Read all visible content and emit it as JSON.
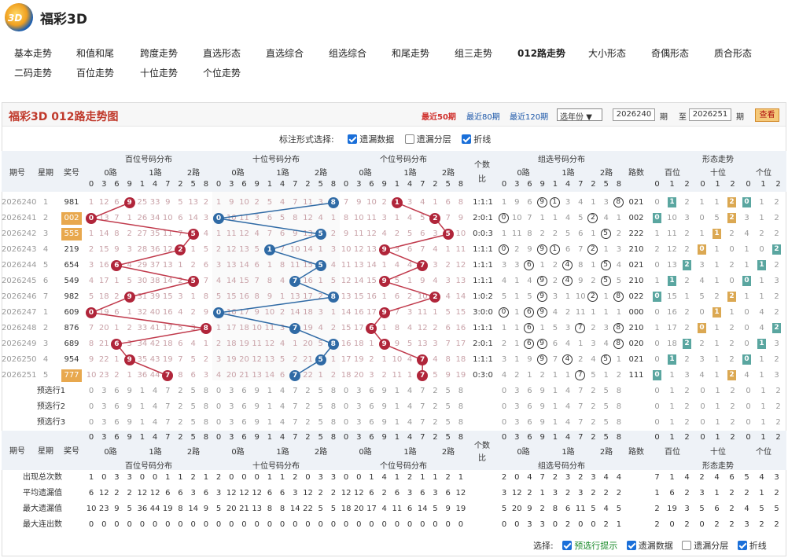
{
  "app": {
    "title": "福彩3D"
  },
  "nav": {
    "row1": [
      "基本走势",
      "和值和尾",
      "跨度走势",
      "直选形态",
      "直选综合",
      "组选综合",
      "和尾走势",
      "组三走势",
      "012路走势",
      "大小形态",
      "奇偶形态",
      "质合形态"
    ],
    "row2": [
      "二码走势",
      "百位走势",
      "十位走势",
      "个位走势"
    ],
    "active": "012路走势"
  },
  "panel": {
    "title": "福彩3D 012路走势图",
    "links": [
      "最近50期",
      "最近80期",
      "最近120期"
    ],
    "year_select": "选年份",
    "from_label": "期",
    "to_label": "至",
    "end_label": "期",
    "from_value": "2026240",
    "to_value": "2026251",
    "view_button": "查看"
  },
  "mark_options": {
    "label": "标注形式选择:",
    "items": [
      {
        "label": "遗漏数据",
        "checked": true
      },
      {
        "label": "遗漏分层",
        "checked": false
      },
      {
        "label": "折线",
        "checked": true
      }
    ]
  },
  "headers": {
    "issue": "期号",
    "week": "星期",
    "prize": "奖号",
    "hundreds": "百位号码分布",
    "tens": "十位号码分布",
    "units": "个位号码分布",
    "ratio1": "个数",
    "ratio2": "比",
    "group": "组选号码分布",
    "route": "路数",
    "shape": "形态走势",
    "pos": [
      "百位",
      "十位",
      "个位"
    ],
    "paths": [
      "0路",
      "1路",
      "2路"
    ],
    "digits": [
      "0",
      "3",
      "6",
      "9",
      "1",
      "4",
      "7",
      "2",
      "5",
      "8"
    ],
    "routes012": [
      "0",
      "1",
      "2"
    ]
  },
  "rows": [
    {
      "issue": "2026240",
      "week": "1",
      "prize": "981",
      "ratio": "1:1:1",
      "route": "021"
    },
    {
      "issue": "2026241",
      "week": "2",
      "prize": "002",
      "ratio": "2:0:1",
      "route": "002"
    },
    {
      "issue": "2026242",
      "week": "3",
      "prize": "555",
      "ratio": "0:0:3",
      "route": "222"
    },
    {
      "issue": "2026243",
      "week": "4",
      "prize": "219",
      "ratio": "1:1:1",
      "route": "210"
    },
    {
      "issue": "2026244",
      "week": "5",
      "prize": "654",
      "ratio": "1:1:1",
      "route": "021"
    },
    {
      "issue": "2026245",
      "week": "6",
      "prize": "549",
      "ratio": "1:1:1",
      "route": "210"
    },
    {
      "issue": "2026246",
      "week": "7",
      "prize": "982",
      "ratio": "1:0:2",
      "route": "022"
    },
    {
      "issue": "2026247",
      "week": "1",
      "prize": "609",
      "ratio": "3:0:0",
      "route": "000"
    },
    {
      "issue": "2026248",
      "week": "2",
      "prize": "876",
      "ratio": "1:1:1",
      "route": "210"
    },
    {
      "issue": "2026249",
      "week": "3",
      "prize": "689",
      "ratio": "2:0:1",
      "route": "020"
    },
    {
      "issue": "2026250",
      "week": "4",
      "prize": "954",
      "ratio": "1:1:1",
      "route": "021"
    },
    {
      "issue": "2026251",
      "week": "5",
      "prize": "777",
      "ratio": "0:3:0",
      "route": "111"
    }
  ],
  "hundreds_miss": [
    [
      "1",
      "12",
      "6",
      "9",
      "25",
      "33",
      "9",
      "5",
      "13",
      "2"
    ],
    [
      "0",
      "13",
      "7",
      "1",
      "26",
      "34",
      "10",
      "6",
      "14",
      "3"
    ],
    [
      "1",
      "14",
      "8",
      "2",
      "27",
      "35",
      "11",
      "7",
      "5",
      "4"
    ],
    [
      "2",
      "15",
      "9",
      "3",
      "28",
      "36",
      "12",
      "2",
      "1",
      "5"
    ],
    [
      "3",
      "16",
      "6",
      "4",
      "29",
      "37",
      "13",
      "1",
      "2",
      "6"
    ],
    [
      "4",
      "17",
      "1",
      "5",
      "30",
      "38",
      "14",
      "2",
      "5",
      "7"
    ],
    [
      "5",
      "18",
      "2",
      "9",
      "31",
      "39",
      "15",
      "3",
      "1",
      "8"
    ],
    [
      "6",
      "19",
      "6",
      "1",
      "32",
      "40",
      "16",
      "4",
      "2",
      "9"
    ],
    [
      "7",
      "20",
      "1",
      "2",
      "33",
      "41",
      "17",
      "5",
      "3",
      "8"
    ],
    [
      "8",
      "21",
      "6",
      "3",
      "34",
      "42",
      "18",
      "6",
      "4",
      "1"
    ],
    [
      "9",
      "22",
      "1",
      "9",
      "35",
      "43",
      "19",
      "7",
      "5",
      "2"
    ],
    [
      "10",
      "23",
      "2",
      "1",
      "36",
      "44",
      "7",
      "8",
      "6",
      "3"
    ]
  ],
  "tens_miss": [
    [
      "1",
      "9",
      "10",
      "2",
      "5",
      "4",
      "7",
      "11",
      "3",
      "8"
    ],
    [
      "0",
      "10",
      "11",
      "3",
      "6",
      "5",
      "8",
      "12",
      "4",
      "1"
    ],
    [
      "1",
      "11",
      "12",
      "4",
      "7",
      "6",
      "9",
      "13",
      "5",
      "2"
    ],
    [
      "2",
      "12",
      "13",
      "5",
      "1",
      "7",
      "10",
      "14",
      "1",
      "3"
    ],
    [
      "3",
      "13",
      "14",
      "6",
      "1",
      "8",
      "11",
      "15",
      "5",
      "4"
    ],
    [
      "4",
      "14",
      "15",
      "7",
      "8",
      "4",
      "12",
      "16",
      "1",
      "5"
    ],
    [
      "5",
      "15",
      "16",
      "8",
      "9",
      "1",
      "13",
      "17",
      "2",
      "8"
    ],
    [
      "0",
      "16",
      "17",
      "9",
      "10",
      "2",
      "14",
      "18",
      "3",
      "1"
    ],
    [
      "1",
      "17",
      "18",
      "10",
      "11",
      "3",
      "7",
      "19",
      "4",
      "2"
    ],
    [
      "2",
      "18",
      "19",
      "11",
      "12",
      "4",
      "1",
      "20",
      "5",
      "8"
    ],
    [
      "3",
      "19",
      "20",
      "12",
      "13",
      "5",
      "2",
      "21",
      "5",
      "1"
    ],
    [
      "4",
      "20",
      "21",
      "13",
      "14",
      "6",
      "7",
      "22",
      "1",
      "2"
    ]
  ],
  "units_miss": [
    [
      "7",
      "9",
      "10",
      "2",
      "1",
      "3",
      "4",
      "1",
      "6",
      "8"
    ],
    [
      "8",
      "10",
      "11",
      "3",
      "1",
      "4",
      "5",
      "2",
      "7",
      "9"
    ],
    [
      "9",
      "11",
      "12",
      "4",
      "2",
      "5",
      "6",
      "3",
      "5",
      "10"
    ],
    [
      "10",
      "12",
      "13",
      "9",
      "3",
      "6",
      "7",
      "4",
      "1",
      "11"
    ],
    [
      "11",
      "13",
      "14",
      "1",
      "4",
      "4",
      "8",
      "3",
      "2",
      "12"
    ],
    [
      "12",
      "14",
      "15",
      "9",
      "5",
      "1",
      "9",
      "4",
      "3",
      "13"
    ],
    [
      "13",
      "15",
      "16",
      "1",
      "6",
      "2",
      "10",
      "2",
      "4",
      "14"
    ],
    [
      "14",
      "16",
      "17",
      "9",
      "7",
      "3",
      "11",
      "1",
      "5",
      "15"
    ],
    [
      "15",
      "17",
      "6",
      "1",
      "8",
      "4",
      "12",
      "2",
      "6",
      "16"
    ],
    [
      "16",
      "18",
      "1",
      "9",
      "9",
      "5",
      "13",
      "3",
      "7",
      "17"
    ],
    [
      "17",
      "19",
      "2",
      "1",
      "10",
      "4",
      "14",
      "4",
      "8",
      "18"
    ],
    [
      "18",
      "20",
      "3",
      "2",
      "11",
      "1",
      "7",
      "5",
      "9",
      "19"
    ]
  ],
  "group_miss": [
    [
      "1",
      "9",
      "6",
      "9",
      "1",
      "3",
      "4",
      "1",
      "3",
      "8"
    ],
    [
      "0",
      "10",
      "7",
      "1",
      "1",
      "4",
      "5",
      "2",
      "4",
      "1"
    ],
    [
      "1",
      "11",
      "8",
      "2",
      "2",
      "5",
      "6",
      "1",
      "5",
      "2"
    ],
    [
      "1",
      "2",
      "9",
      "9",
      "1",
      "6",
      "7",
      "2",
      "1",
      "3"
    ],
    [
      "3",
      "3",
      "6",
      "1",
      "2",
      "4",
      "8",
      "1",
      "5",
      "4"
    ],
    [
      "4",
      "1",
      "4",
      "9",
      "2",
      "4",
      "9",
      "2",
      "5",
      "5"
    ],
    [
      "5",
      "1",
      "5",
      "9",
      "3",
      "1",
      "10",
      "2",
      "1",
      "8"
    ],
    [
      "0",
      "1",
      "6",
      "9",
      "4",
      "2",
      "11",
      "1",
      "1",
      "1"
    ],
    [
      "1",
      "1",
      "6",
      "1",
      "5",
      "3",
      "7",
      "2",
      "3",
      "8"
    ],
    [
      "2",
      "1",
      "6",
      "9",
      "6",
      "4",
      "1",
      "3",
      "4",
      "8"
    ],
    [
      "3",
      "1",
      "9",
      "9",
      "7",
      "4",
      "2",
      "4",
      "5",
      "1"
    ],
    [
      "4",
      "2",
      "1",
      "2",
      "1",
      "1",
      "7",
      "5",
      "1",
      "2"
    ]
  ],
  "group_hits": [
    [
      3,
      4,
      9
    ],
    [
      0,
      7
    ],
    [
      8
    ],
    [
      0,
      3,
      4,
      7
    ],
    [
      2,
      5,
      8
    ],
    [
      3,
      5,
      8
    ],
    [
      3,
      7,
      9
    ],
    [
      0,
      2,
      3
    ],
    [
      2,
      6,
      9
    ],
    [
      2,
      3,
      9
    ],
    [
      3,
      5,
      8
    ],
    [
      6
    ]
  ],
  "shape_cells": [
    [
      "0",
      "9",
      "2",
      "1",
      "1",
      "2",
      "1",
      "1",
      "2"
    ],
    [
      "0",
      "10",
      "3",
      "0",
      "5",
      "1",
      "3",
      "1",
      "2"
    ],
    [
      "1",
      "11",
      "2",
      "1",
      "6",
      "2",
      "4",
      "2",
      "2"
    ],
    [
      "2",
      "12",
      "2",
      "2",
      "1",
      "0",
      "1",
      "0",
      "3"
    ],
    [
      "0",
      "13",
      "1",
      "3",
      "1",
      "2",
      "1",
      "1",
      "2"
    ],
    [
      "1",
      "14",
      "2",
      "4",
      "1",
      "0",
      "0",
      "1",
      "3"
    ],
    [
      "0",
      "15",
      "1",
      "5",
      "2",
      "2",
      "1",
      "1",
      "2"
    ],
    [
      "0",
      "16",
      "2",
      "0",
      "2",
      "1",
      "0",
      "4",
      "2"
    ],
    [
      "1",
      "17",
      "2",
      "1",
      "1",
      "2",
      "0",
      "4",
      "2"
    ],
    [
      "0",
      "18",
      "1",
      "2",
      "1",
      "2",
      "0",
      "5",
      "3"
    ],
    [
      "0",
      "19",
      "2",
      "3",
      "1",
      "2",
      "0",
      "1",
      "2"
    ],
    [
      "1",
      "1",
      "3",
      "4",
      "1",
      "3",
      "4",
      "1",
      "3"
    ]
  ],
  "hits": {
    "hundreds": [
      3,
      0,
      8,
      7,
      2,
      8,
      3,
      0,
      9,
      2,
      3,
      6
    ],
    "tens": [
      9,
      0,
      8,
      4,
      8,
      6,
      9,
      0,
      6,
      9,
      8,
      6
    ],
    "units": [
      4,
      7,
      8,
      3,
      6,
      3,
      7,
      3,
      2,
      3,
      6,
      6
    ]
  },
  "forecast": {
    "labels": [
      "预选行1",
      "预选行2",
      "预选行3"
    ],
    "digits": [
      "0",
      "3",
      "6",
      "9",
      "1",
      "4",
      "7",
      "2",
      "5",
      "8"
    ]
  },
  "stats": {
    "labels": [
      "出现总次数",
      "平均遗漏值",
      "最大遗漏值",
      "最大连出数"
    ],
    "hundreds": [
      [
        "1",
        "0",
        "3",
        "3",
        "0",
        "0",
        "1",
        "1",
        "2",
        "1"
      ],
      [
        "6",
        "12",
        "2",
        "2",
        "12",
        "12",
        "6",
        "6",
        "3",
        "6"
      ],
      [
        "10",
        "23",
        "9",
        "5",
        "36",
        "44",
        "19",
        "8",
        "14",
        "9"
      ],
      [
        "0",
        "0",
        "0",
        "0",
        "0",
        "0",
        "0",
        "0",
        "0",
        "0"
      ]
    ],
    "tens": [
      [
        "2",
        "0",
        "0",
        "0",
        "1",
        "1",
        "2",
        "0",
        "3",
        "3"
      ],
      [
        "3",
        "12",
        "12",
        "12",
        "6",
        "6",
        "3",
        "12",
        "2",
        "2"
      ],
      [
        "5",
        "20",
        "21",
        "13",
        "8",
        "8",
        "14",
        "22",
        "5",
        "5"
      ],
      [
        "0",
        "0",
        "0",
        "0",
        "0",
        "0",
        "0",
        "0",
        "0",
        "0"
      ]
    ],
    "units": [
      [
        "0",
        "0",
        "1",
        "4",
        "1",
        "2",
        "1",
        "1",
        "2",
        "1"
      ],
      [
        "12",
        "12",
        "6",
        "2",
        "6",
        "3",
        "6",
        "3",
        "6",
        "12"
      ],
      [
        "18",
        "20",
        "17",
        "4",
        "11",
        "6",
        "14",
        "5",
        "9",
        "19"
      ],
      [
        "0",
        "0",
        "0",
        "0",
        "0",
        "0",
        "0",
        "0",
        "0",
        "0"
      ]
    ],
    "group": [
      [
        "2",
        "0",
        "4",
        "7",
        "2",
        "3",
        "2",
        "3",
        "4",
        "4"
      ],
      [
        "3",
        "12",
        "2",
        "1",
        "3",
        "2",
        "3",
        "2",
        "2",
        "2"
      ],
      [
        "5",
        "20",
        "9",
        "2",
        "8",
        "6",
        "11",
        "5",
        "4",
        "5"
      ],
      [
        "0",
        "0",
        "3",
        "3",
        "0",
        "2",
        "0",
        "0",
        "2",
        "1"
      ]
    ],
    "shape": [
      [
        "7",
        "1",
        "4",
        "2",
        "4",
        "6",
        "5",
        "4",
        "3"
      ],
      [
        "1",
        "6",
        "2",
        "3",
        "1",
        "2",
        "2",
        "1",
        "2"
      ],
      [
        "2",
        "19",
        "3",
        "5",
        "6",
        "2",
        "4",
        "5",
        "5"
      ],
      [
        "2",
        "0",
        "2",
        "0",
        "2",
        "2",
        "3",
        "2",
        "2"
      ]
    ]
  },
  "footer": {
    "label": "选择:",
    "items": [
      {
        "label": "预选行提示",
        "checked": true,
        "green": true
      },
      {
        "label": "遗漏数据",
        "checked": true
      },
      {
        "label": "遗漏分层",
        "checked": false
      },
      {
        "label": "折线",
        "checked": true
      }
    ]
  }
}
